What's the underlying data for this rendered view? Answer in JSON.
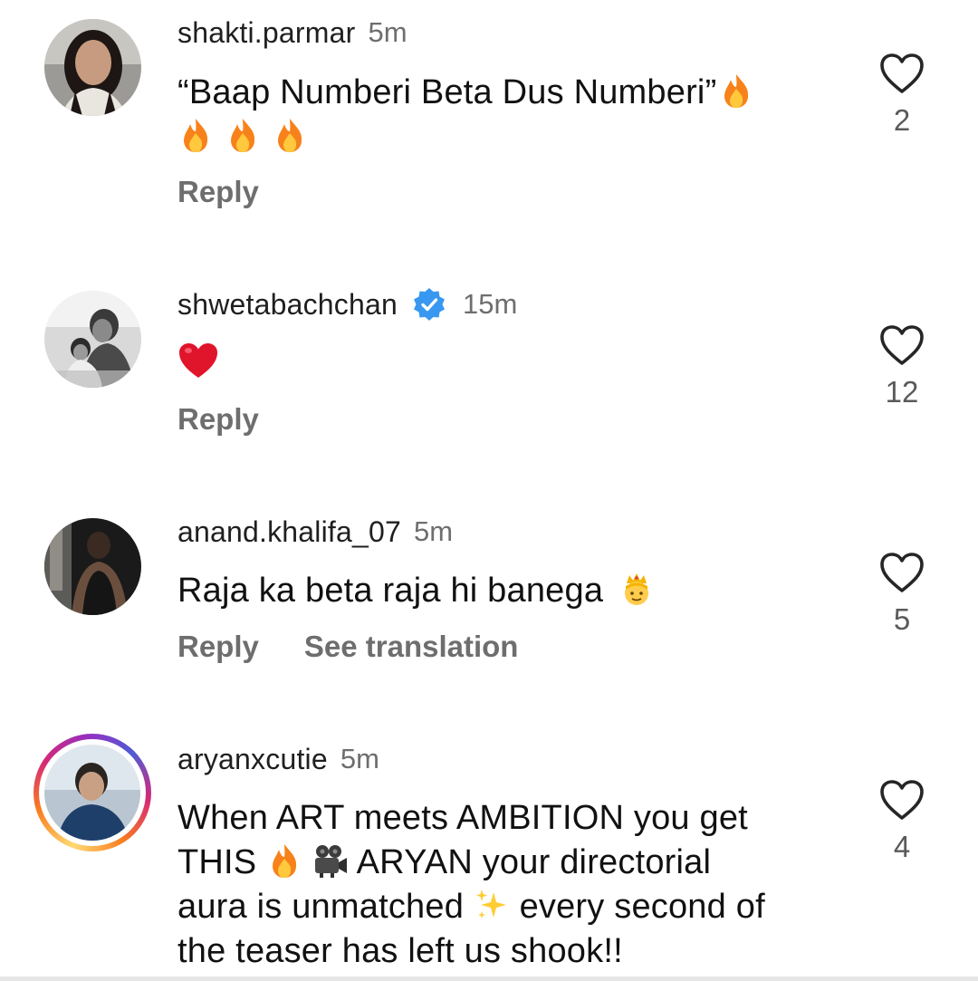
{
  "comments": [
    {
      "username": "shakti.parmar",
      "time": "5m",
      "verified": false,
      "text_1": "“Baap Numberi Beta Dus Numberi”",
      "emoji_1": "fire",
      "emoji_line2": [
        "fire",
        "fire",
        "fire"
      ],
      "reply_label": "Reply",
      "like_count": "2"
    },
    {
      "username": "shwetabachchan",
      "time": "15m",
      "verified": true,
      "emoji_body": "red-heart",
      "reply_label": "Reply",
      "like_count": "12"
    },
    {
      "username": "anand.khalifa_07",
      "time": "5m",
      "verified": false,
      "text_1": "Raja ka beta raja hi banega",
      "emoji_1": "prince",
      "reply_label": "Reply",
      "translate_label": "See translation",
      "like_count": "5"
    },
    {
      "username": "aryanxcutie",
      "time": "5m",
      "verified": false,
      "has_story_ring": true,
      "line_1": "When ART meets AMBITION you get",
      "line_2a": "THIS",
      "line_2b": "ARYAN your directorial",
      "line_3a": "aura is unmatched",
      "line_3b": "every second of",
      "line_4": "the teaser has left us shook!!",
      "emojis": [
        "fire",
        "movie-camera",
        "sparkles"
      ],
      "like_count": "4"
    }
  ],
  "colors": {
    "text": "#111111",
    "muted": "#6e6e6e",
    "verified_blue": "#3897f0",
    "heart_red": "#e0142b"
  },
  "icons": {
    "like": "heart-outline-icon",
    "verified": "verified-badge-icon"
  }
}
